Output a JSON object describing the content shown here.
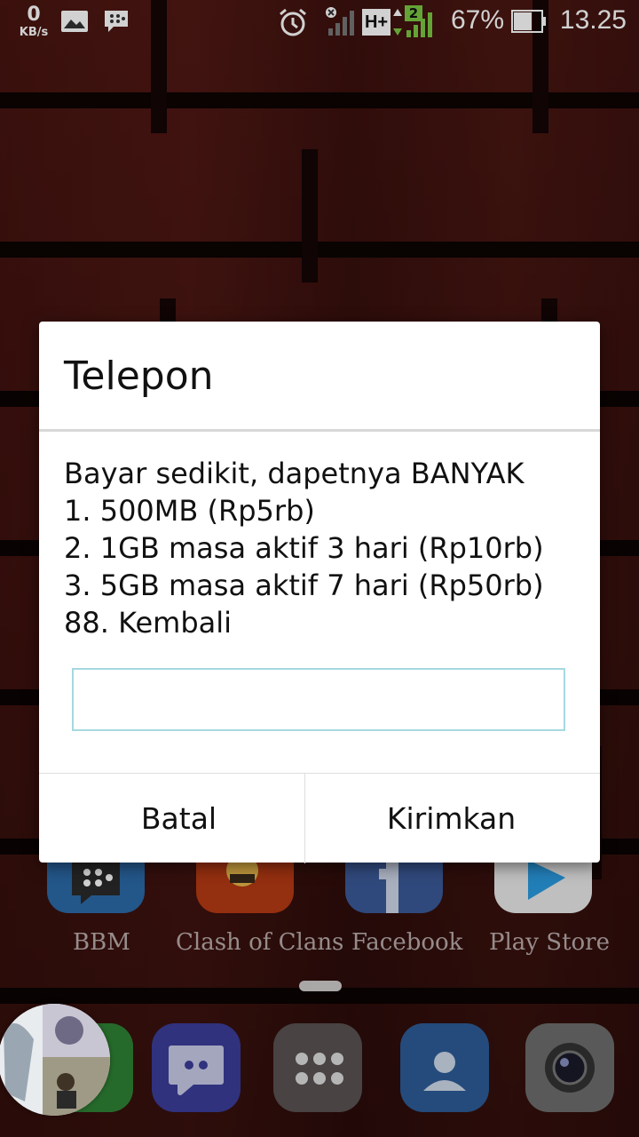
{
  "status_bar": {
    "speed_value": "0",
    "speed_unit": "KB/s",
    "network_type": "H+",
    "sim_slot": "2",
    "battery_percent": "67%",
    "time": "13.25"
  },
  "dialog": {
    "title": "Telepon",
    "message_lines": [
      "Bayar sedikit, dapetnya BANYAK",
      "1. 500MB (Rp5rb)",
      "2. 1GB masa aktif 3 hari (Rp10rb)",
      "3. 5GB masa aktif 7 hari (Rp50rb)",
      "88. Kembali"
    ],
    "input_value": "",
    "cancel_label": "Batal",
    "send_label": "Kirimkan"
  },
  "home_apps": [
    {
      "label": "BBM",
      "icon": "bbm-icon"
    },
    {
      "label": "Clash of Clans",
      "icon": "clash-of-clans-icon"
    },
    {
      "label": "Facebook",
      "icon": "facebook-icon"
    },
    {
      "label": "Play Store",
      "icon": "play-store-icon"
    }
  ],
  "dock": [
    {
      "icon": "messaging-icon"
    },
    {
      "icon": "app-drawer-icon"
    },
    {
      "icon": "contacts-icon"
    },
    {
      "icon": "camera-icon"
    }
  ],
  "colors": {
    "input_border": "#a7d8e0",
    "signal_green": "#7ac943"
  }
}
